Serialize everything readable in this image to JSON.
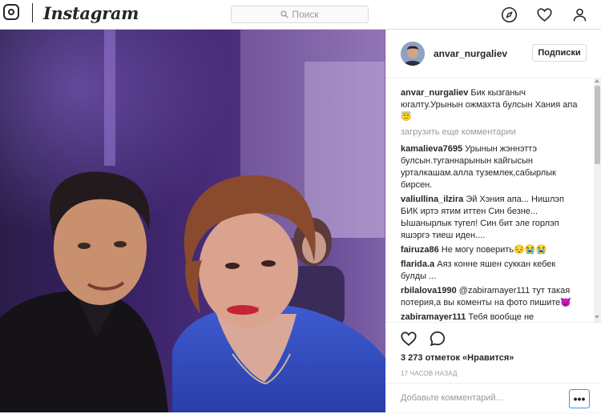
{
  "topbar": {
    "brand": "Instagram",
    "search_placeholder": "Поиск"
  },
  "post": {
    "author": "anvar_nurgaliev",
    "follow_label": "Подписки",
    "caption": {
      "user": "anvar_nurgaliev",
      "text": " Бик кызганыч югалту.Урынын ожмахта булсын Хания апа😇"
    },
    "load_more": "загрузить еще комментарии",
    "comments": [
      {
        "user": "kamalieva7695",
        "text": " Урынын жэннэттэ булсын.туганнарынын кайгысын урталкашам.алла туземлек,сабырлык бирсен."
      },
      {
        "user": "valiullina_ilzira",
        "text": " Эй Хэния апа... Нишлэп БИК иртэ ятим иттен Син безне... Ышанырлык тугел! Син бит эле горлэп яшэргэ тиеш иден...."
      },
      {
        "user": "fairuza86",
        "text": " Не могу поверить😔😭😭"
      },
      {
        "user": "flarida.a",
        "text": " Аяз конне яшен суккан кебек булды ..."
      },
      {
        "user": "rbilalova1990",
        "text": " @zabiramayer111 тут такая потерия,а вы коменты на фото пишите👿"
      },
      {
        "user": "zabiramayer111",
        "text": " Тебя вообще не"
      }
    ],
    "likes": "3 273 отметок «Нравится»",
    "time": "17 ЧАСОВ НАЗАД",
    "add_comment_placeholder": "Добавьте комментарий...",
    "more_label": "•••"
  }
}
